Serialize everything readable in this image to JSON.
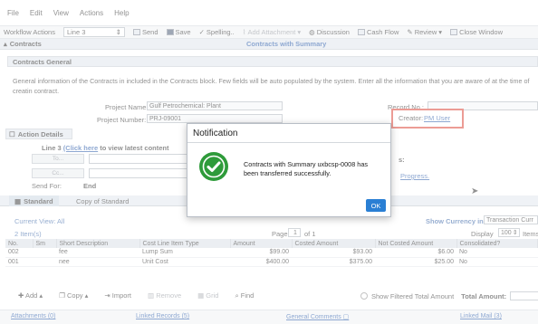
{
  "menu": [
    "File",
    "Edit",
    "View",
    "Actions",
    "Help"
  ],
  "toolbar": {
    "workflow_label": "Workflow Actions",
    "workflow_value": "Line 3",
    "send": "Send",
    "save": "Save",
    "spelling": "Spelling..",
    "add_attachment": "Add Attachment",
    "discussion": "Discussion",
    "cash_flow": "Cash Flow",
    "review": "Review",
    "close_window": "Close Window"
  },
  "header": {
    "section": "Contracts",
    "title": "Contracts with Summary"
  },
  "general": {
    "title": "Contracts General",
    "description": "General information of the Contracts in included in the Contracts block. Few fields will be auto populated by the system. Enter all the information that you are aware of at the time of creatin contract.",
    "project_name_label": "Project Name:",
    "project_name_value": "Gulf Petrochemical: Plant",
    "project_number_label": "Project Number:",
    "project_number_value": "PRJ-09001",
    "record_no_label": "Record No.:",
    "creator_label": "Creator:",
    "creator_value": "PM User"
  },
  "action_details": {
    "title": "Action Details",
    "line_prefix": "Line 3",
    "click_here": "(Click here",
    "line_suffix": "to view latest content",
    "to_btn": "To...",
    "cc_btn": "Cc...",
    "send_for_label": "Send For:",
    "send_for_value": "End",
    "progress_link": "Progress."
  },
  "tabs": [
    "Standard",
    "Copy of Standard"
  ],
  "grid_bar": {
    "current_view": "Current View: All",
    "show_currency_label": "Show Currency in:",
    "currency_value": "Transaction Curr",
    "items": "2 Item(s)",
    "page_label": "Page",
    "page_value": "1",
    "page_of": "of 1",
    "display_label": "Display",
    "display_value": "100",
    "items_label": "Items"
  },
  "table": {
    "headers": [
      "No.",
      "Sm",
      "Short Description",
      "Cost Line Item Type",
      "Amount",
      "Costed Amount",
      "Not Costed Amount",
      "Consolidated?"
    ],
    "rows": [
      [
        "002",
        "",
        "fee",
        "Lump Sum",
        "$99.00",
        "$93.00",
        "$6.00",
        "No"
      ],
      [
        "001",
        "",
        "nee",
        "Unit Cost",
        "$400.00",
        "$375.00",
        "$25.00",
        "No"
      ]
    ]
  },
  "grid_actions": {
    "add": "Add",
    "copy": "Copy",
    "import": "Import",
    "remove": "Remove",
    "grid": "Grid",
    "find": "Find",
    "show_filtered": "Show Filtered Total Amount",
    "total_amount": "Total Amount:"
  },
  "bottom": {
    "attachments": "Attachments (0)",
    "linked_records": "Linked Records (5)",
    "general_comments": "General Comments",
    "linked_mail": "Linked Mail (3)"
  },
  "dialog": {
    "title": "Notification",
    "message": "Contracts with Summary uxbcsp-0008 has been transferred successfully.",
    "ok": "OK",
    "success_color": "#2e9b3a"
  }
}
